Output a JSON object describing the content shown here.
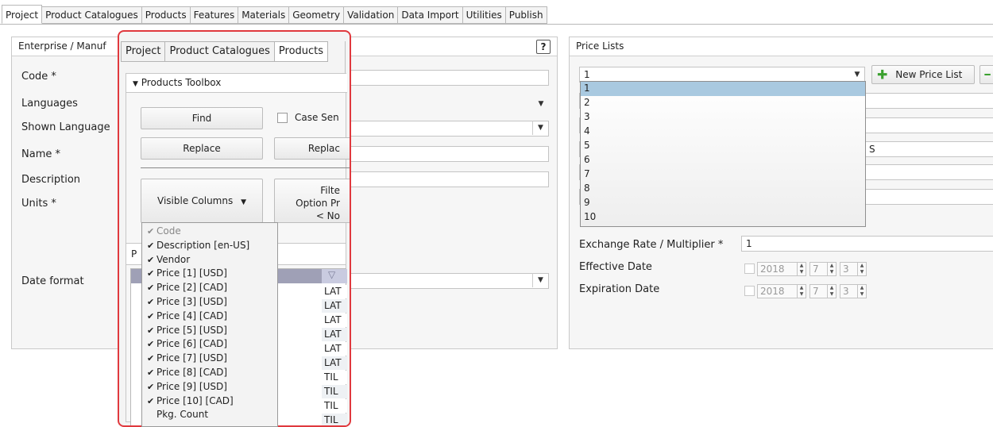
{
  "main_tabs": [
    "Project",
    "Product Catalogues",
    "Products",
    "Features",
    "Materials",
    "Geometry",
    "Validation",
    "Data Import",
    "Utilities",
    "Publish"
  ],
  "left_panel": {
    "title": "Enterprise / Manuf",
    "help": "?",
    "labels": {
      "code": "Code *",
      "languages": "Languages",
      "shown_language": "Shown Language",
      "name": "Name *",
      "description": "Description",
      "units": "Units *",
      "date_format": "Date format"
    }
  },
  "overlay": {
    "tabs": [
      "Project",
      "Product Catalogues",
      "Products"
    ],
    "toolbox_title": "Products Toolbox",
    "find": "Find",
    "case_sensitive": "Case Sen",
    "replace": "Replace",
    "replace_all": "Replac",
    "visible_columns": "Visible Columns",
    "filter_line1": "Filte",
    "filter_line2": "Option Pr",
    "filter_line3": "< No",
    "partial_label": "P"
  },
  "columns_menu": [
    {
      "label": "Code",
      "checked": true,
      "dim": true
    },
    {
      "label": "Description [en-US]",
      "checked": true
    },
    {
      "label": "Vendor",
      "checked": true
    },
    {
      "label": "Price [1] [USD]",
      "checked": true
    },
    {
      "label": "Price [2] [CAD]",
      "checked": true
    },
    {
      "label": "Price [3] [USD]",
      "checked": true
    },
    {
      "label": "Price [4] [CAD]",
      "checked": true
    },
    {
      "label": "Price [5] [USD]",
      "checked": true
    },
    {
      "label": "Price [6] [CAD]",
      "checked": true
    },
    {
      "label": "Price [7] [USD]",
      "checked": true
    },
    {
      "label": "Price [8] [CAD]",
      "checked": true
    },
    {
      "label": "Price [9] [USD]",
      "checked": true
    },
    {
      "label": "Price [10] [CAD]",
      "checked": true
    },
    {
      "label": "Pkg. Count",
      "checked": false
    }
  ],
  "grid_right_cells": [
    "LAT",
    "LAT",
    "LAT",
    "LAT",
    "LAT",
    "LAT",
    "TIL",
    "TIL",
    "TIL",
    "TIL"
  ],
  "price_lists": {
    "title": "Price Lists",
    "selected_value": "1",
    "new_button": "New Price List",
    "options": [
      "1",
      "2",
      "3",
      "4",
      "5",
      "6",
      "7",
      "8",
      "9",
      "10"
    ],
    "partial_value": "S",
    "exchange_rate_label": "Exchange Rate / Multiplier *",
    "exchange_rate_value": "1",
    "effective_date_label": "Effective Date",
    "expiration_date_label": "Expiration Date",
    "effective_year": "2018",
    "effective_month": "7",
    "effective_day": "3",
    "expiration_year": "2018",
    "expiration_month": "7",
    "expiration_day": "3"
  }
}
